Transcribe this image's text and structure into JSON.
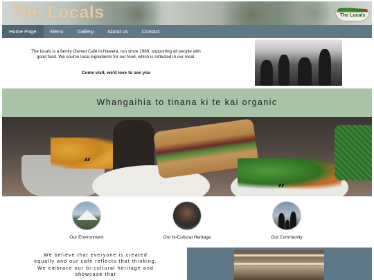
{
  "header": {
    "site_title": "The Locals",
    "logo_text": "The Locals"
  },
  "nav": {
    "items": [
      {
        "label": "Home Page",
        "active": true
      },
      {
        "label": "Menu",
        "active": false
      },
      {
        "label": "Gallery",
        "active": false
      },
      {
        "label": "About us",
        "active": false
      },
      {
        "label": "Contact",
        "active": false
      }
    ]
  },
  "intro": {
    "text": "The locals is a family Owned Café in Hawera, run since 1986, supporting all people with good food. We source local ingredients for our food, which is reflected in our meal.",
    "cta": "Come visit, we'd love to see you"
  },
  "banner": {
    "text": "Whangaihia to tinana ki te kai organic"
  },
  "hero": {
    "quote_open": "“",
    "quote_close": "”"
  },
  "features": [
    {
      "label": "Our Environment",
      "icon": "mountain-icon"
    },
    {
      "label": "Our bi-Cultural Heritage",
      "icon": "person-portrait-icon"
    },
    {
      "label": "Our Community",
      "icon": "family-silhouette-icon"
    }
  ],
  "values": {
    "text": "We believe that everyone is created equally and our café reflects that thinking. We embrace our bi-cultural heritage and showcase that"
  },
  "colors": {
    "nav_bg": "#5f7888",
    "nav_active_bg": "#4d6472",
    "banner_bg": "#a8c3a6",
    "title_color": "#e9c9a0"
  }
}
